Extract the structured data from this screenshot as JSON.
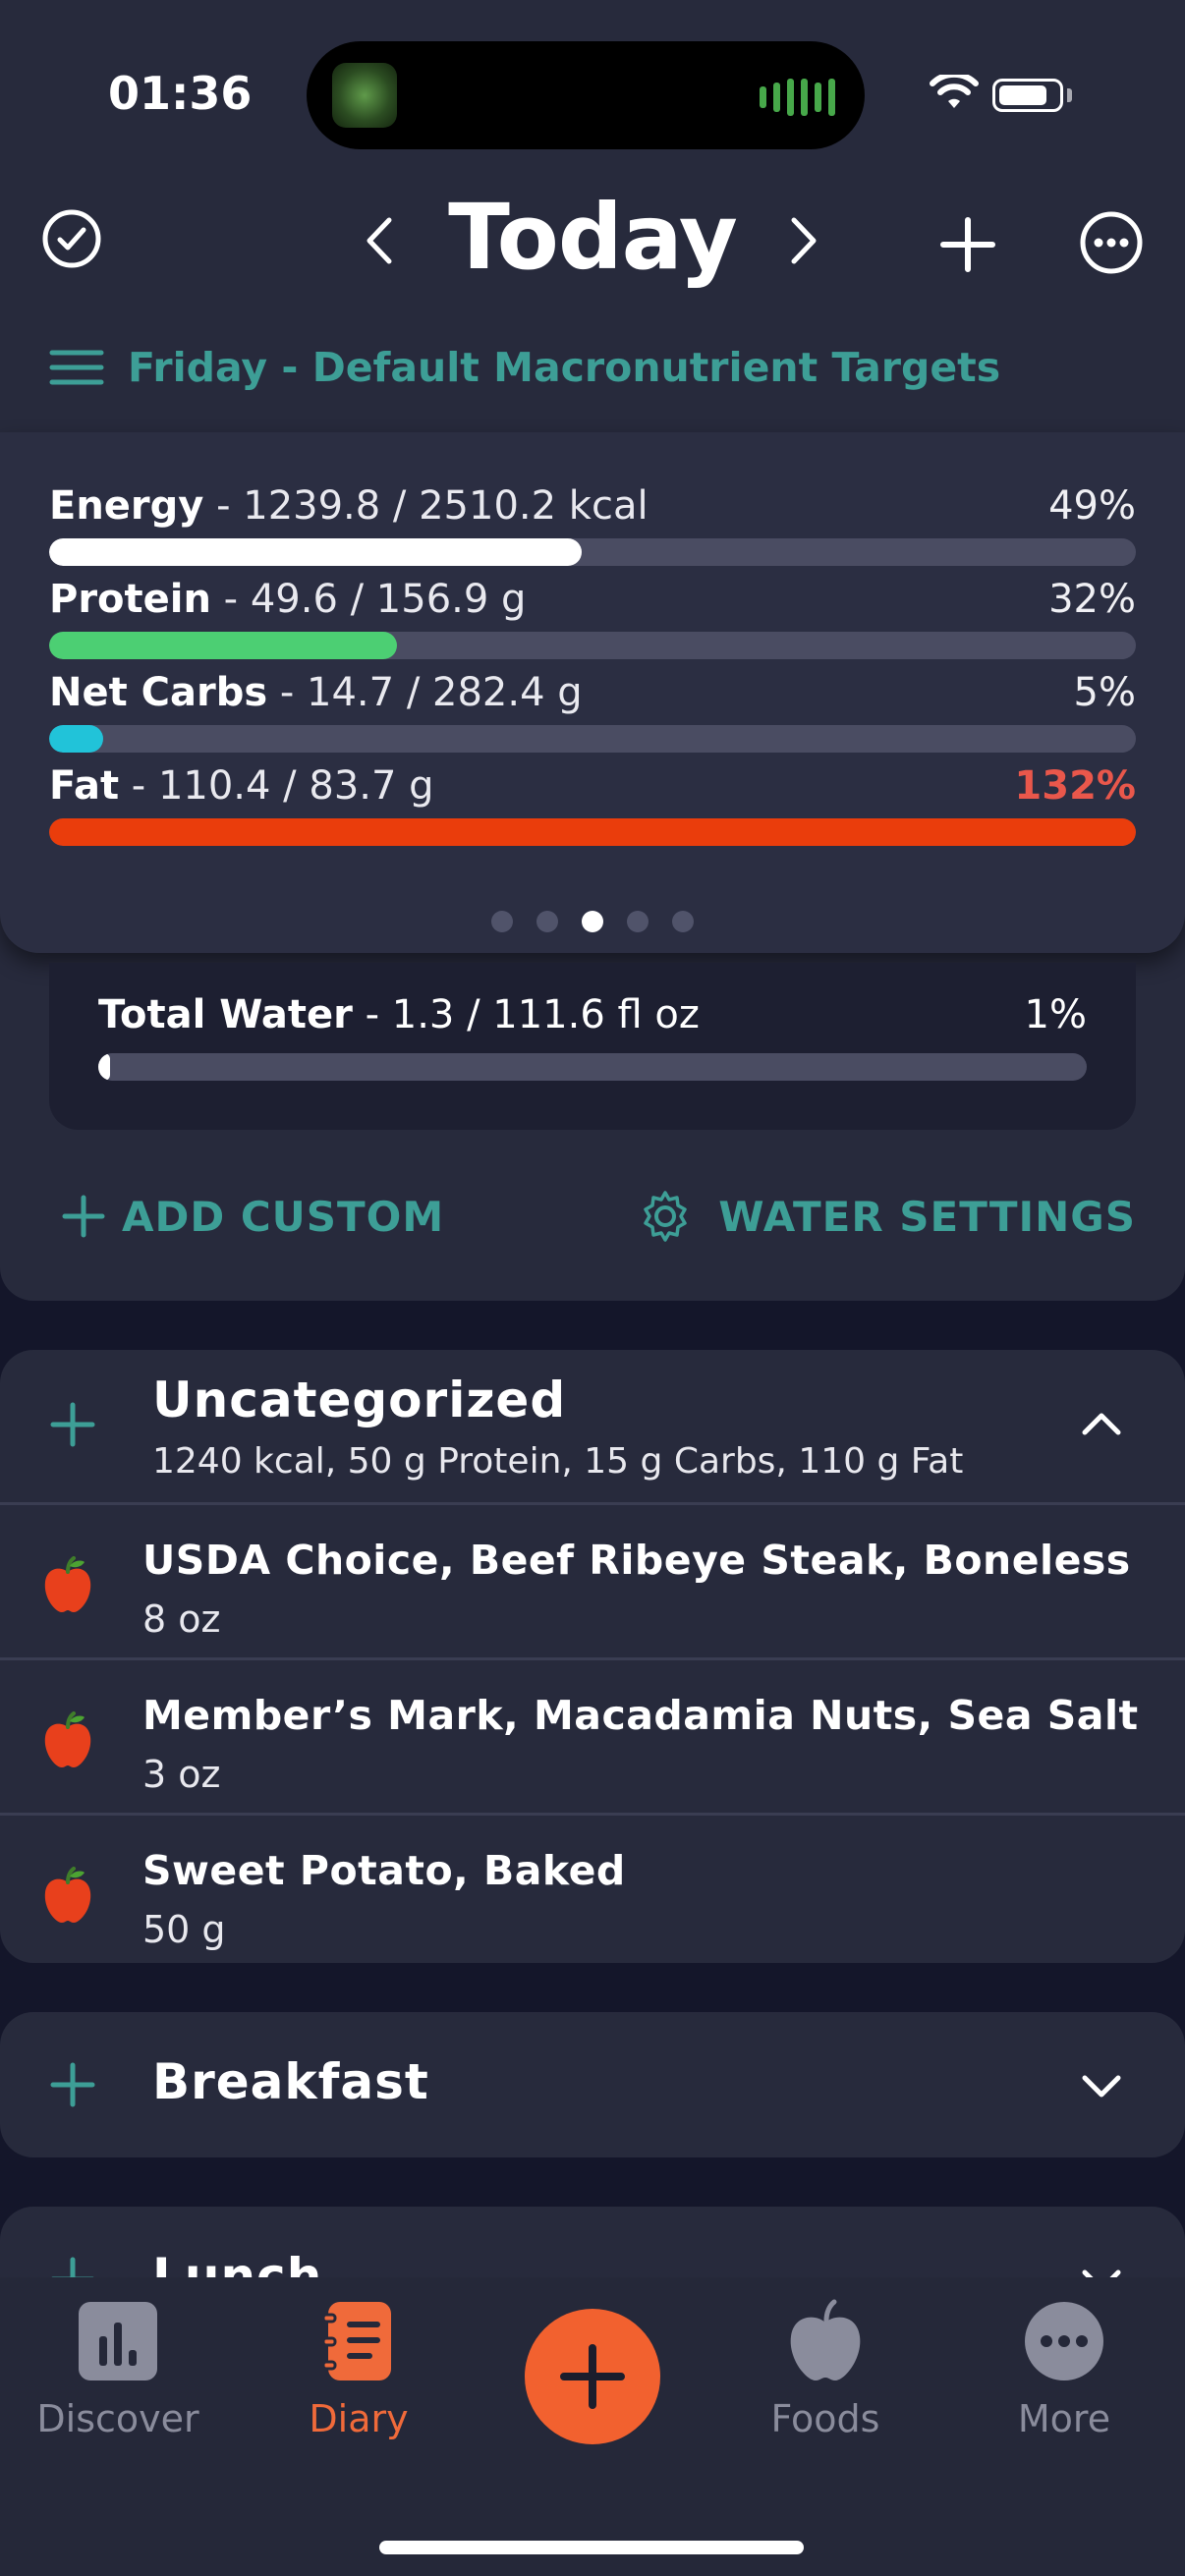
{
  "status": {
    "time": "01:36"
  },
  "header": {
    "title": "Today"
  },
  "targets": {
    "label": "Friday - Default Macronutrient Targets"
  },
  "macros": [
    {
      "name": "Energy",
      "detail": " - 1239.8 / 2510.2 kcal",
      "pct": "49%",
      "fill": 0.49,
      "color": "#ffffff",
      "pct_color": "#f0f0f4"
    },
    {
      "name": "Protein",
      "detail": " - 49.6 / 156.9 g",
      "pct": "32%",
      "fill": 0.32,
      "color": "#4ccf73",
      "pct_color": "#f0f0f4"
    },
    {
      "name": "Net Carbs",
      "detail": " - 14.7 / 282.4 g",
      "pct": "5%",
      "fill": 0.05,
      "color": "#21c3d9",
      "pct_color": "#f0f0f4"
    },
    {
      "name": "Fat",
      "detail": " - 110.4 / 83.7 g",
      "pct": "132%",
      "fill": 1.0,
      "color": "#ea3d0c",
      "pct_color": "#e9574b"
    }
  ],
  "pager": {
    "count": 5,
    "active": 2
  },
  "water": {
    "name": "Total Water",
    "detail": " - 1.3 / 111.6 fl oz",
    "pct": "1%",
    "fill": 0.012
  },
  "actions": {
    "add_custom": "ADD CUSTOM",
    "water_settings": "WATER SETTINGS"
  },
  "sections": {
    "uncategorized": {
      "title": "Uncategorized",
      "summary": "1240 kcal, 50 g Protein, 15 g Carbs, 110 g Fat",
      "items": [
        {
          "name": "USDA Choice, Beef Ribeye Steak, Boneless",
          "qty": "8 oz"
        },
        {
          "name": "Member’s Mark, Macadamia Nuts, Sea Salt",
          "qty": "3 oz"
        },
        {
          "name": "Sweet Potato, Baked",
          "qty": "50 g"
        }
      ]
    },
    "breakfast": {
      "title": "Breakfast"
    },
    "lunch": {
      "title": "Lunch"
    }
  },
  "tabs": {
    "discover": "Discover",
    "diary": "Diary",
    "foods": "Foods",
    "more": "More"
  },
  "colors": {
    "accent": "#3d9e96",
    "active_tab": "#f06a3a",
    "fab": "#f2612f",
    "apple": "#e8401c"
  }
}
